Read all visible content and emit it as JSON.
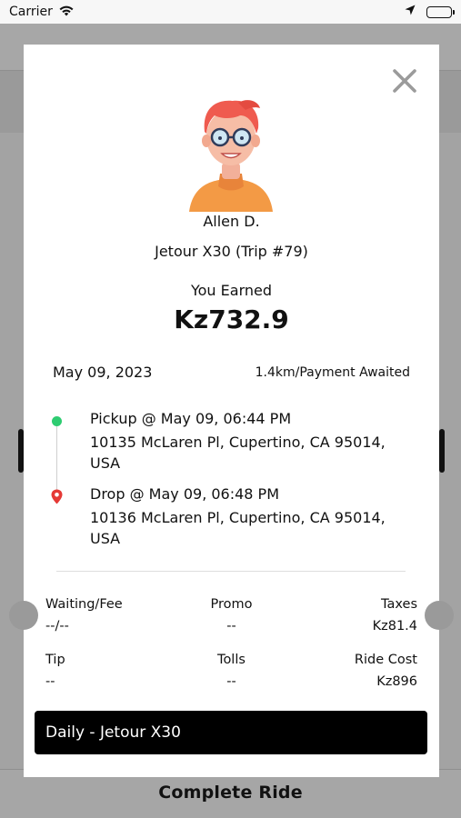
{
  "status_bar": {
    "carrier": "Carrier"
  },
  "background": {
    "header_title": "",
    "bottom_button": "Complete Ride"
  },
  "modal": {
    "driver_name": "Allen D.",
    "vehicle_trip": "Jetour X30 (Trip #79)",
    "earned_label": "You Earned",
    "earned_amount": "Kz732.9",
    "date": "May 09, 2023",
    "distance_status": "1.4km/Payment Awaited",
    "pickup": {
      "title": "Pickup @ May 09, 06:44 PM",
      "address": "10135 McLaren Pl, Cupertino, CA 95014, USA"
    },
    "drop": {
      "title": "Drop @ May 09, 06:48 PM",
      "address": "10136 McLaren Pl, Cupertino, CA 95014, USA"
    },
    "fees": {
      "waiting_label": "Waiting/Fee",
      "waiting_value": "--/--",
      "promo_label": "Promo",
      "promo_value": "--",
      "taxes_label": "Taxes",
      "taxes_value": "Kz81.4",
      "tip_label": "Tip",
      "tip_value": "--",
      "tolls_label": "Tolls",
      "tolls_value": "--",
      "ride_cost_label": "Ride Cost",
      "ride_cost_value": "Kz896"
    },
    "plan": "Daily - Jetour X30"
  },
  "colors": {
    "pickup_dot": "#2ecc71",
    "drop_pin": "#e53935",
    "plan_bar": "#000000"
  },
  "icons": {
    "close": "close-icon",
    "avatar": "avatar-illustration",
    "wifi": "wifi-icon",
    "location": "location-arrow-icon",
    "battery": "battery-icon"
  }
}
